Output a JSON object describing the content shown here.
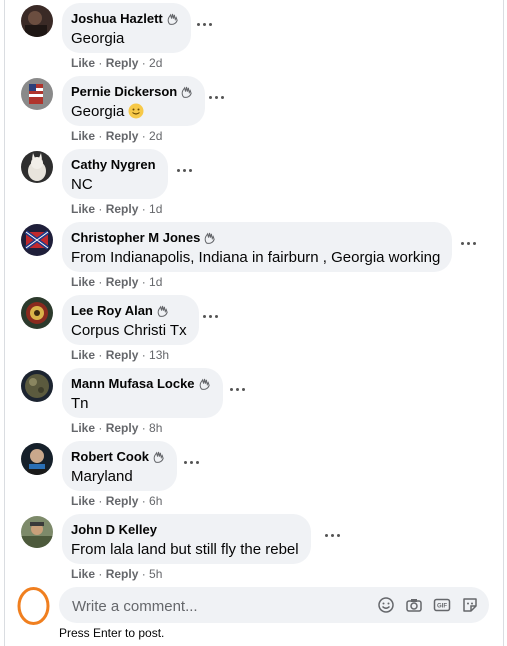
{
  "colors": {
    "bubble": "#f0f2f5",
    "meta": "#65676b",
    "highlight_ring": "#f07f1f"
  },
  "comments": [
    {
      "author": "Joshua Hazlett",
      "text": "Georgia",
      "like": "Like",
      "reply": "Reply",
      "time": "2d",
      "avatar_icon": "profile-photo-dark"
    },
    {
      "author": "Pernie Dickerson",
      "text": "Georgia",
      "like": "Like",
      "reply": "Reply",
      "time": "2d",
      "avatar_icon": "profile-photo-flag",
      "emoji_icon": "smiling-face-emoji"
    },
    {
      "author": "Cathy Nygren",
      "text": "NC",
      "like": "Like",
      "reply": "Reply",
      "time": "1d",
      "avatar_icon": "profile-photo-cat"
    },
    {
      "author": "Christopher M Jones",
      "text": "From Indianapolis, Indiana in fairburn , Georgia working",
      "like": "Like",
      "reply": "Reply",
      "time": "1d",
      "avatar_icon": "profile-photo-flag-red"
    },
    {
      "author": "Lee Roy Alan",
      "text": "Corpus Christi Tx",
      "like": "Like",
      "reply": "Reply",
      "time": "13h",
      "avatar_icon": "profile-photo-emblem"
    },
    {
      "author": "Mann Mufasa Locke",
      "text": "Tn",
      "like": "Like",
      "reply": "Reply",
      "time": "8h",
      "avatar_icon": "profile-photo-planet"
    },
    {
      "author": "Robert Cook",
      "text": "Maryland",
      "like": "Like",
      "reply": "Reply",
      "time": "6h",
      "avatar_icon": "profile-photo-person"
    },
    {
      "author": "John D Kelley",
      "text": "From lala land but still fly the rebel",
      "like": "Like",
      "reply": "Reply",
      "time": "5h",
      "avatar_icon": "profile-photo-outdoor"
    }
  ],
  "composer": {
    "placeholder": "Write a comment...",
    "hint": "Press Enter to post.",
    "tools": [
      "emoji-icon",
      "camera-icon",
      "gif-icon",
      "sticker-icon"
    ]
  }
}
